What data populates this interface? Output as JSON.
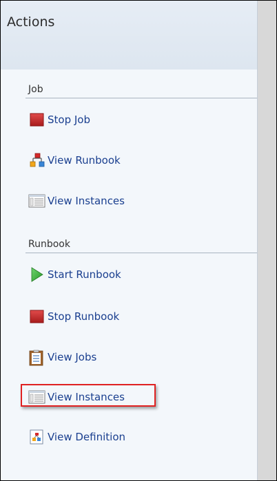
{
  "panel": {
    "title": "Actions"
  },
  "sections": {
    "job": {
      "label": "Job",
      "items": [
        {
          "label": "Stop Job",
          "icon": "stop-icon"
        },
        {
          "label": "View Runbook",
          "icon": "runbook-icon"
        },
        {
          "label": "View Instances",
          "icon": "instances-icon"
        }
      ]
    },
    "runbook": {
      "label": "Runbook",
      "items": [
        {
          "label": "Start Runbook",
          "icon": "play-icon"
        },
        {
          "label": "Stop Runbook",
          "icon": "stop-icon"
        },
        {
          "label": "View Jobs",
          "icon": "clipboard-icon"
        },
        {
          "label": "View Instances",
          "icon": "instances-icon",
          "highlighted": true
        },
        {
          "label": "View Definition",
          "icon": "definition-icon"
        }
      ]
    }
  },
  "colors": {
    "highlight": "#e02020",
    "link": "#1a3f8f",
    "stop": "#c62828",
    "play": "#3cae3c"
  }
}
